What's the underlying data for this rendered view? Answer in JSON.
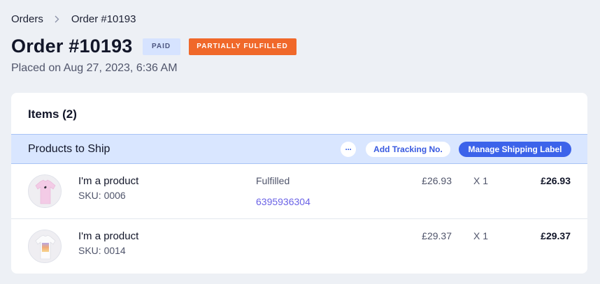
{
  "breadcrumb": {
    "parent": "Orders",
    "current": "Order #10193"
  },
  "header": {
    "title": "Order #10193",
    "payment_badge": "PAID",
    "fulfillment_badge": "PARTIALLY FULFILLED",
    "placed": "Placed on Aug 27, 2023, 6:36 AM"
  },
  "items_card": {
    "title": "Items (2)",
    "ship_section": {
      "label": "Products to Ship",
      "more_label": "···",
      "add_tracking_label": "Add Tracking No.",
      "manage_label_button": "Manage Shipping Label"
    },
    "items": [
      {
        "name": "I'm a product",
        "sku": "SKU: 0006",
        "status": "Fulfilled",
        "tracking": "6395936304",
        "price": "£26.93",
        "qty": "X 1",
        "total": "£26.93",
        "image": "pink-tshirt-icon"
      },
      {
        "name": "I'm a product",
        "sku": "SKU: 0014",
        "status": "",
        "tracking": "",
        "price": "£29.37",
        "qty": "X 1",
        "total": "£29.37",
        "image": "gradient-tshirt-icon"
      }
    ]
  },
  "colors": {
    "accent": "#3c63ea",
    "fulfillment_badge_bg": "#f0682a",
    "paid_badge_bg": "#d6e3ff",
    "ship_bar_bg": "#d9e6ff",
    "tracking_link": "#6b63e6"
  }
}
